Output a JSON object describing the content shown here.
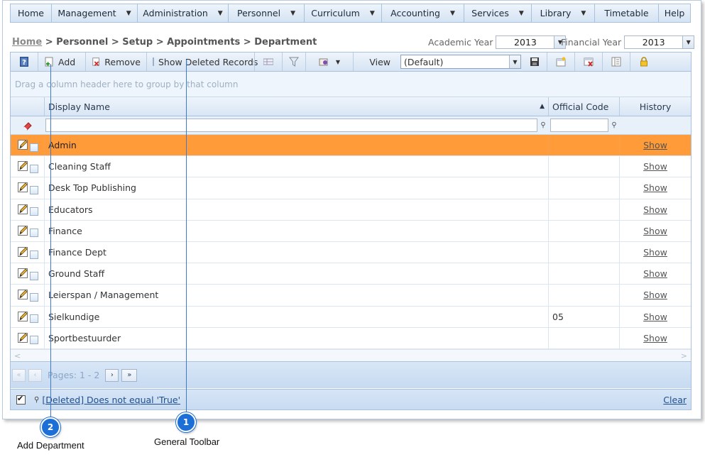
{
  "menu": {
    "items": [
      {
        "label": "Home",
        "has_dropdown": false
      },
      {
        "label": "Management",
        "has_dropdown": true
      },
      {
        "label": "Administration",
        "has_dropdown": true
      },
      {
        "label": "Personnel",
        "has_dropdown": true
      },
      {
        "label": "Curriculum",
        "has_dropdown": true
      },
      {
        "label": "Accounting",
        "has_dropdown": true
      },
      {
        "label": "Services",
        "has_dropdown": true
      },
      {
        "label": "Library",
        "has_dropdown": true
      },
      {
        "label": "Timetable",
        "has_dropdown": false
      },
      {
        "label": "Help",
        "has_dropdown": false
      }
    ]
  },
  "breadcrumb": {
    "home": "Home",
    "path": " > Personnel > Setup > Appointments > Department"
  },
  "years": {
    "academic_label": "Academic Year",
    "academic_value": "2013",
    "financial_label": "Financial Year",
    "financial_value": "2013"
  },
  "toolbar": {
    "add_label": "Add",
    "remove_label": "Remove",
    "show_deleted_label": "Show Deleted Records",
    "view_label": "View",
    "view_value": "(Default)"
  },
  "grid": {
    "group_hint": "Drag a column header here to group by that column",
    "columns": {
      "display_name": "Display Name",
      "official_code": "Official Code",
      "history": "History"
    },
    "rows": [
      {
        "name": "Admin",
        "code": "",
        "history": "Show",
        "selected": true
      },
      {
        "name": "Cleaning Staff",
        "code": "",
        "history": "Show",
        "selected": false
      },
      {
        "name": "Desk Top Publishing",
        "code": "",
        "history": "Show",
        "selected": false
      },
      {
        "name": "Educators",
        "code": "",
        "history": "Show",
        "selected": false
      },
      {
        "name": "Finance",
        "code": "",
        "history": "Show",
        "selected": false
      },
      {
        "name": "Finance Dept",
        "code": "",
        "history": "Show",
        "selected": false
      },
      {
        "name": "Ground Staff",
        "code": "",
        "history": "Show",
        "selected": false
      },
      {
        "name": "Leierspan / Management",
        "code": "",
        "history": "Show",
        "selected": false
      },
      {
        "name": "Sielkundige",
        "code": "05",
        "history": "Show",
        "selected": false
      },
      {
        "name": "Sportbestuurder",
        "code": "",
        "history": "Show",
        "selected": false
      }
    ]
  },
  "pager": {
    "pages_text": "Pages: 1 - 2"
  },
  "filter_status": {
    "text": "[Deleted] Does not equal 'True'",
    "clear_label": "Clear"
  },
  "callouts": [
    {
      "number": "1",
      "label": "General Toolbar"
    },
    {
      "number": "2",
      "label": "Add Department"
    }
  ],
  "colors": {
    "accent": "#1d6fd8",
    "selected_row": "#ff9b38",
    "toolbar_bg": "#d6e4f4"
  }
}
